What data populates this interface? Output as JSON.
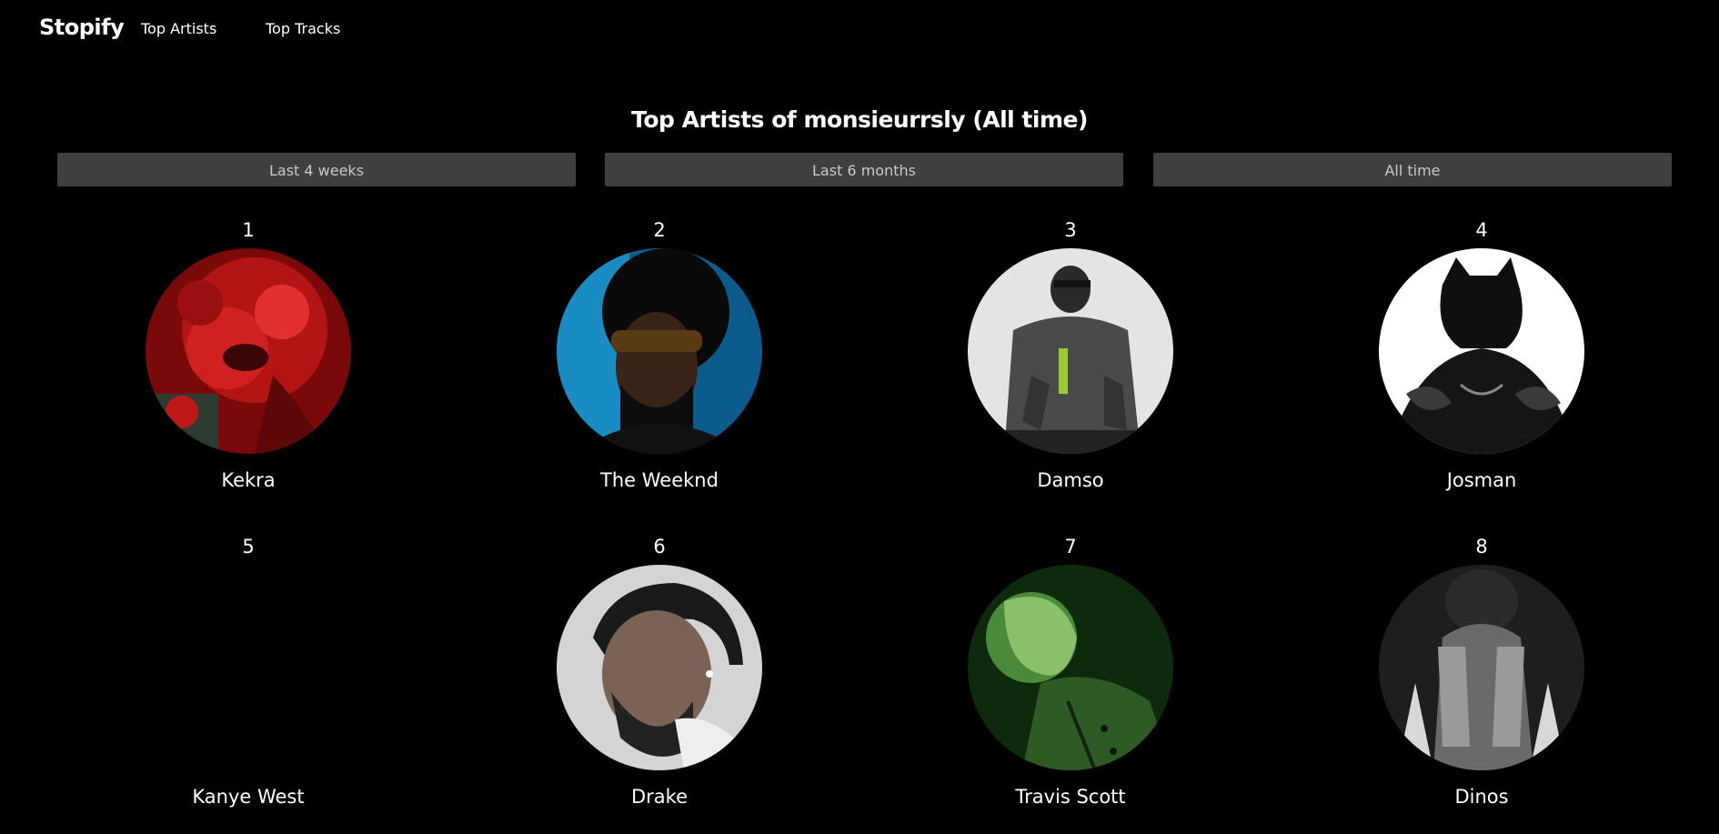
{
  "nav": {
    "brand": "Stopify",
    "links": [
      "Top Artists",
      "Top Tracks"
    ]
  },
  "title": "Top Artists of monsieurrsly (All time)",
  "ranges": [
    "Last 4 weeks",
    "Last 6 months",
    "All time"
  ],
  "artists": [
    {
      "rank": "1",
      "name": "Kekra",
      "has_image": true
    },
    {
      "rank": "2",
      "name": "The Weeknd",
      "has_image": true
    },
    {
      "rank": "3",
      "name": "Damso",
      "has_image": true
    },
    {
      "rank": "4",
      "name": "Josman",
      "has_image": true
    },
    {
      "rank": "5",
      "name": "Kanye West",
      "has_image": false
    },
    {
      "rank": "6",
      "name": "Drake",
      "has_image": true
    },
    {
      "rank": "7",
      "name": "Travis Scott",
      "has_image": true
    },
    {
      "rank": "8",
      "name": "Dinos",
      "has_image": true
    }
  ],
  "colors": {
    "background": "#000000",
    "button": "#3f3f3f",
    "button_text": "#c8c8c8",
    "text": "#ffffff"
  }
}
